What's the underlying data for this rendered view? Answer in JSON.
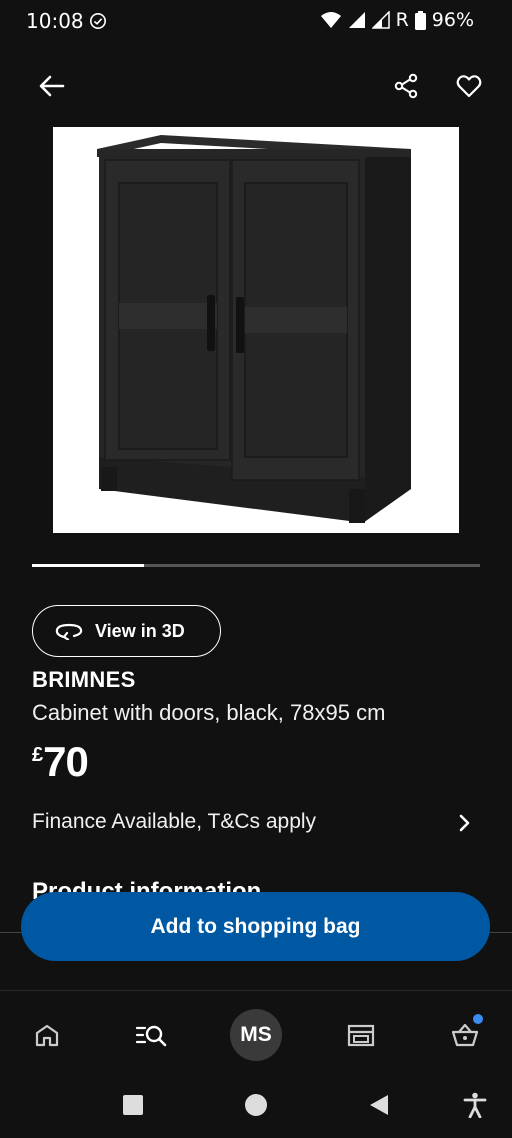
{
  "status_bar": {
    "time": "10:08",
    "network_label": "R",
    "battery": "96%"
  },
  "product": {
    "name": "BRIMNES",
    "description": "Cabinet with doors, black, 78x95 cm",
    "price_currency": "£",
    "price_value": "70",
    "view_3d_label": "View in 3D",
    "finance_label": "Finance Available, T&Cs apply",
    "section_heading": "Product information",
    "image_carousel_progress": 0.25
  },
  "actions": {
    "add_to_bag_label": "Add to shopping bag"
  },
  "bottom_nav": {
    "avatar_initials": "MS"
  },
  "colors": {
    "background": "#111111",
    "primary_button": "#0058a3",
    "badge": "#3b8cf0"
  },
  "icons": [
    "check-circle-icon",
    "wifi-icon",
    "signal-icon",
    "battery-icon",
    "back-arrow-icon",
    "share-icon",
    "heart-icon",
    "rotate-3d-icon",
    "chevron-right-icon",
    "home-icon",
    "search-list-icon",
    "store-icon",
    "basket-icon",
    "square-icon",
    "circle-icon",
    "triangle-back-icon",
    "accessibility-icon"
  ]
}
